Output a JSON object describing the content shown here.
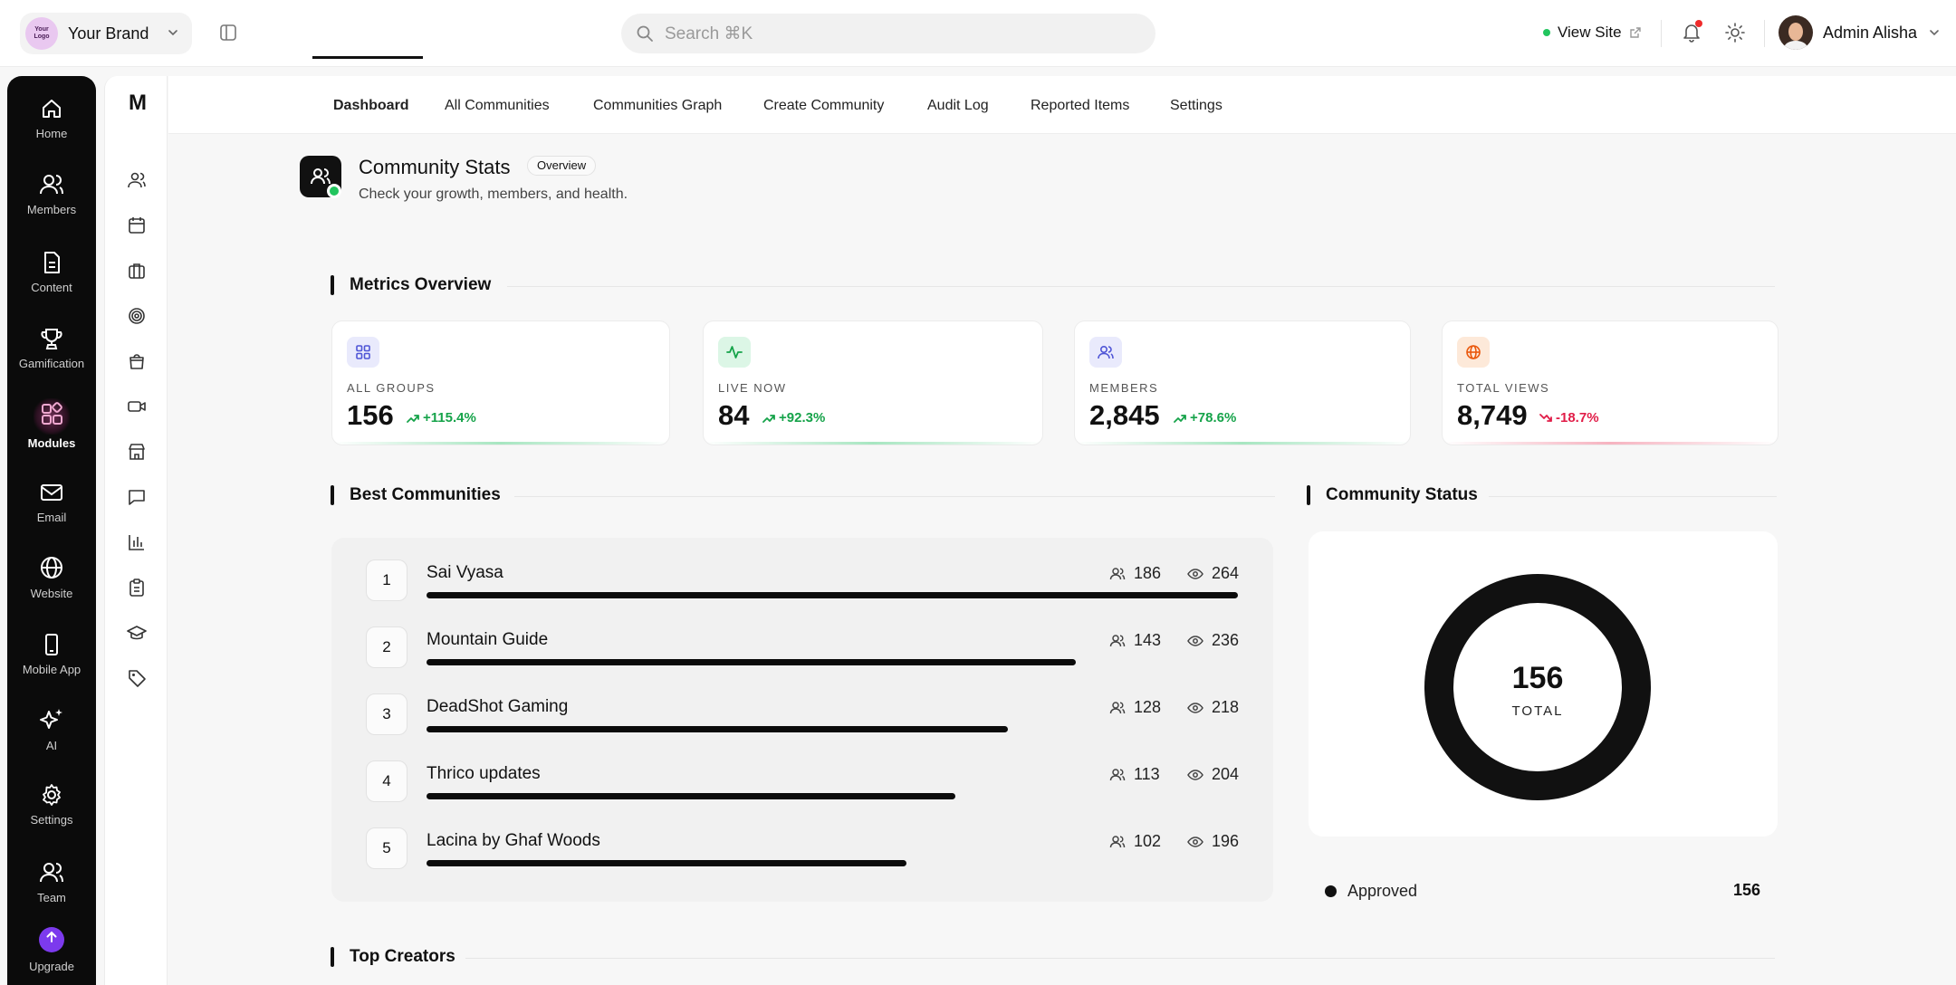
{
  "brand": {
    "name": "Your Brand",
    "logo_line1": "Your",
    "logo_line2": "Logo"
  },
  "search": {
    "placeholder": "Search ⌘K"
  },
  "header_actions": {
    "view_site": "View Site",
    "user_name": "Admin Alisha"
  },
  "dark_nav": [
    {
      "label": "Home",
      "icon": "home-icon"
    },
    {
      "label": "Members",
      "icon": "users-icon"
    },
    {
      "label": "Content",
      "icon": "document-icon"
    },
    {
      "label": "Gamification",
      "icon": "trophy-icon"
    },
    {
      "label": "Modules",
      "icon": "modules-icon",
      "active": true
    },
    {
      "label": "Email",
      "icon": "mail-icon"
    },
    {
      "label": "Website",
      "icon": "globe-icon"
    },
    {
      "label": "Mobile App",
      "icon": "phone-icon"
    },
    {
      "label": "AI",
      "icon": "sparkles-icon"
    },
    {
      "label": "Settings",
      "icon": "gear-icon"
    },
    {
      "label": "Team",
      "icon": "team-icon"
    },
    {
      "label": "Upgrade",
      "icon": "upgrade-icon"
    }
  ],
  "secondary_nav": {
    "logo": "M",
    "icons": [
      "users-icon",
      "calendar-icon",
      "briefcase-icon",
      "target-icon",
      "bag-icon",
      "video-icon",
      "store-icon",
      "chat-icon",
      "bar-chart-icon",
      "clipboard-icon",
      "graduation-cap-icon",
      "tag-icon"
    ]
  },
  "tabs": [
    {
      "label": "Dashboard",
      "active": true
    },
    {
      "label": "All Communities"
    },
    {
      "label": "Communities Graph"
    },
    {
      "label": "Create Community"
    },
    {
      "label": "Audit Log"
    },
    {
      "label": "Reported Items"
    },
    {
      "label": "Settings"
    }
  ],
  "page": {
    "title": "Community Stats",
    "badge": "Overview",
    "subtitle": "Check your growth, members, and health."
  },
  "sections": {
    "metrics": "Metrics Overview",
    "best": "Best Communities",
    "status": "Community Status",
    "creators": "Top Creators"
  },
  "metrics": [
    {
      "label": "ALL GROUPS",
      "value": "156",
      "change": "+115.4%",
      "trend": "up",
      "icon": "grid-icon",
      "accent": "#4f55d6",
      "icon_bg": "#e9eafc"
    },
    {
      "label": "LIVE NOW",
      "value": "84",
      "change": "+92.3%",
      "trend": "up",
      "icon": "activity-icon",
      "accent": "#16a34a",
      "icon_bg": "#dcf6e6"
    },
    {
      "label": "MEMBERS",
      "value": "2,845",
      "change": "+78.6%",
      "trend": "up",
      "icon": "users-icon",
      "accent": "#4f55d6",
      "icon_bg": "#e9eafc"
    },
    {
      "label": "TOTAL VIEWS",
      "value": "8,749",
      "change": "-18.7%",
      "trend": "down",
      "icon": "globe-icon",
      "accent": "#ea580c",
      "icon_bg": "#fde9d9"
    }
  ],
  "colors": {
    "up": "#16a34a",
    "down": "#e11d48"
  },
  "best_communities": [
    {
      "rank": "1",
      "name": "Sai Vyasa",
      "members": "186",
      "views": "264",
      "bar_fraction": 1.0
    },
    {
      "rank": "2",
      "name": "Mountain Guide",
      "members": "143",
      "views": "236",
      "bar_fraction": 0.8
    },
    {
      "rank": "3",
      "name": "DeadShot Gaming",
      "members": "128",
      "views": "218",
      "bar_fraction": 0.717
    },
    {
      "rank": "4",
      "name": "Thrico updates",
      "members": "113",
      "views": "204",
      "bar_fraction": 0.652
    },
    {
      "rank": "5",
      "name": "Lacina by Ghaf Woods",
      "members": "102",
      "views": "196",
      "bar_fraction": 0.591
    }
  ],
  "status": {
    "total": "156",
    "total_label": "TOTAL",
    "legend": [
      {
        "label": "Approved",
        "value": "156",
        "color": "#111111"
      }
    ]
  }
}
